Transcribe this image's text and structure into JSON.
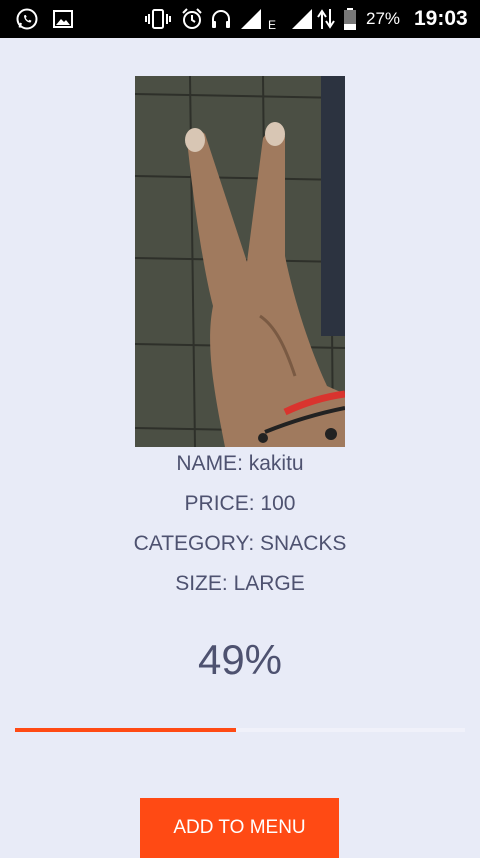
{
  "status_bar": {
    "battery_text": "27%",
    "time": "19:03",
    "network_type": "E",
    "icons": [
      "whatsapp-icon",
      "gallery-icon",
      "vibrate-icon",
      "alarm-icon",
      "headset-icon",
      "signal-icon",
      "data-arrows-icon",
      "battery-icon"
    ]
  },
  "product": {
    "name_line": "NAME: kakitu",
    "price_line": "PRICE: 100",
    "category_line": "CATEGORY: SNACKS",
    "size_line": "SIZE: LARGE"
  },
  "progress": {
    "text": "49%",
    "value": 0.49,
    "fill_color": "#ff4a14"
  },
  "actions": {
    "add_label": "ADD TO MENU"
  },
  "colors": {
    "background": "#e8ebf7",
    "accent": "#ff4a14",
    "text": "#4e5270"
  }
}
